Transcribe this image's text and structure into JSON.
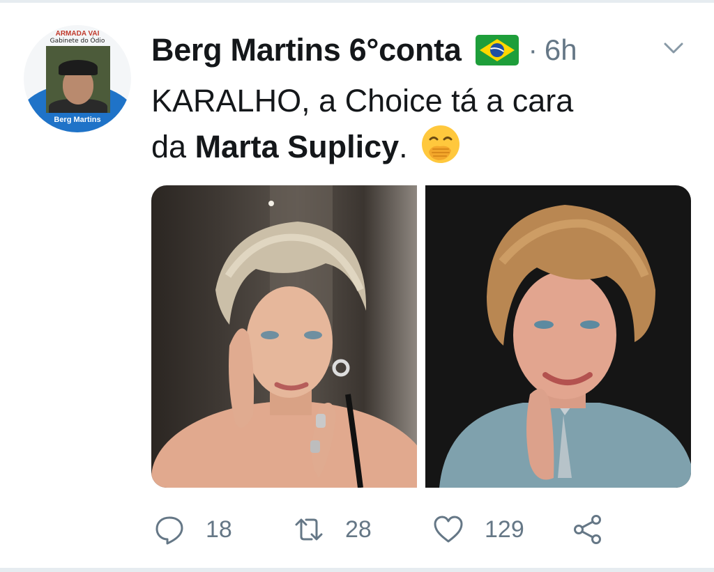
{
  "avatar": {
    "banner_top": "ARMADA VAI",
    "banner_sub": "Gabinete do Ódio",
    "name_plate": "Berg Martins"
  },
  "tweet": {
    "display_name": "Berg Martins 6°conta",
    "separator": "·",
    "time": "6h",
    "text_line1": "KARALHO, a Choice tá a cara",
    "text_pre": "da ",
    "text_bold": "Marta Suplicy",
    "text_post": ".",
    "emoji": "face-with-hand-over-mouth",
    "flag": "brazil-flag"
  },
  "actions": {
    "reply_count": "18",
    "retweet_count": "28",
    "like_count": "129"
  },
  "colors": {
    "text": "#14171a",
    "muted": "#657786",
    "avatar_arc": "#1f73c8"
  }
}
